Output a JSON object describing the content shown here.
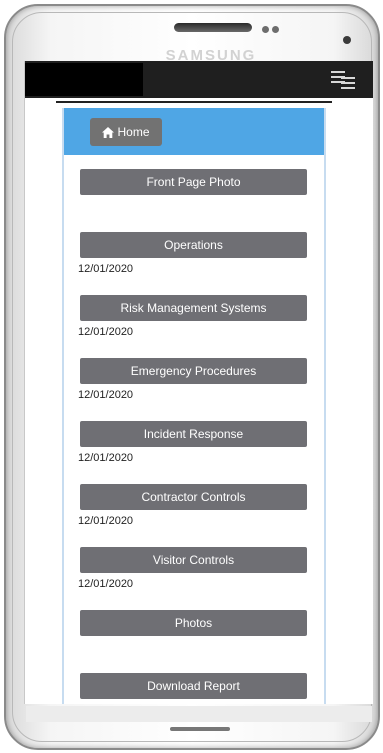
{
  "device": {
    "brand": "SAMSUNG"
  },
  "nav": {
    "home_label": "Home"
  },
  "items": [
    {
      "label": "Front Page Photo",
      "date": ""
    },
    {
      "label": "Operations",
      "date": "12/01/2020"
    },
    {
      "label": "Risk Management Systems",
      "date": "12/01/2020"
    },
    {
      "label": "Emergency Procedures",
      "date": "12/01/2020"
    },
    {
      "label": "Incident Response",
      "date": "12/01/2020"
    },
    {
      "label": "Contractor Controls",
      "date": "12/01/2020"
    },
    {
      "label": "Visitor Controls",
      "date": "12/01/2020"
    },
    {
      "label": "Photos",
      "date": ""
    },
    {
      "label": "Download Report",
      "date": ""
    }
  ],
  "colors": {
    "header_blue": "#4fa6e5",
    "button_gray": "#6f6f74"
  }
}
